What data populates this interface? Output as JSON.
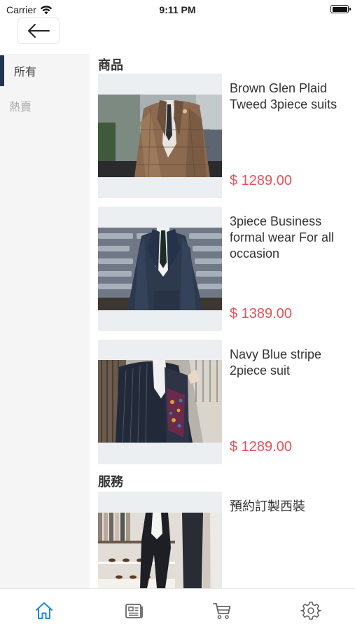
{
  "status": {
    "carrier": "Carrier",
    "time": "9:11 PM"
  },
  "sidebar": {
    "items": [
      {
        "label": "所有",
        "active": true
      },
      {
        "label": "熱賣",
        "active": false
      }
    ]
  },
  "sections": {
    "products_title": "商品",
    "services_title": "服務"
  },
  "products": [
    {
      "name": "Brown Glen Plaid Tweed 3piece suits",
      "price": "$ 1289.00",
      "image": "brown-plaid-suit-photo"
    },
    {
      "name": "3piece Business formal wear For all occasion",
      "price": "$ 1389.00",
      "image": "navy-business-suit-photo"
    },
    {
      "name": "Navy Blue stripe 2piece suit",
      "price": "$ 1289.00",
      "image": "navy-stripe-suit-photo"
    }
  ],
  "services": [
    {
      "name": "預約訂製西裝",
      "image": "tailor-shop-photo"
    }
  ],
  "tabs": [
    {
      "name": "home-icon",
      "active": true
    },
    {
      "name": "news-icon",
      "active": false
    },
    {
      "name": "cart-icon",
      "active": false
    },
    {
      "name": "settings-icon",
      "active": false
    }
  ],
  "colors": {
    "accent": "#1e88e5",
    "price": "#e8525a",
    "indicator": "#23344f",
    "sidebar_bg": "#f5f5f5"
  }
}
